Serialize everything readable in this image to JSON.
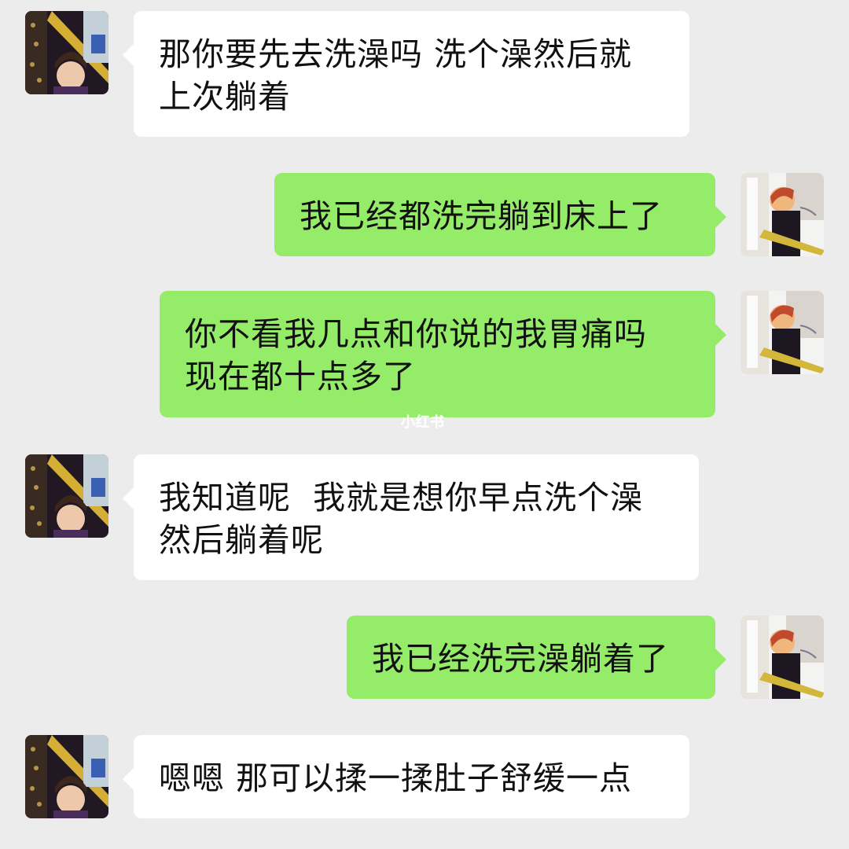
{
  "conversation": {
    "messages": [
      {
        "sender": "other",
        "text": "那你要先去洗澡吗 洗个澡然后就\n上次躺着"
      },
      {
        "sender": "me",
        "text": "我已经都洗完躺到床上了"
      },
      {
        "sender": "me",
        "text": "你不看我几点和你说的我胃痛吗\n现在都十点多了"
      },
      {
        "sender": "other",
        "text": "我知道呢  我就是想你早点洗个澡\n然后躺着呢"
      },
      {
        "sender": "me",
        "text": "我已经洗完澡躺着了"
      },
      {
        "sender": "other",
        "text": "嗯嗯 那可以揉一揉肚子舒缓一点"
      }
    ]
  },
  "watermark": {
    "text": "小红书"
  },
  "colors": {
    "background": "#ececec",
    "incoming_bubble": "#ffffff",
    "outgoing_bubble": "#95ec69",
    "text": "#111111"
  }
}
